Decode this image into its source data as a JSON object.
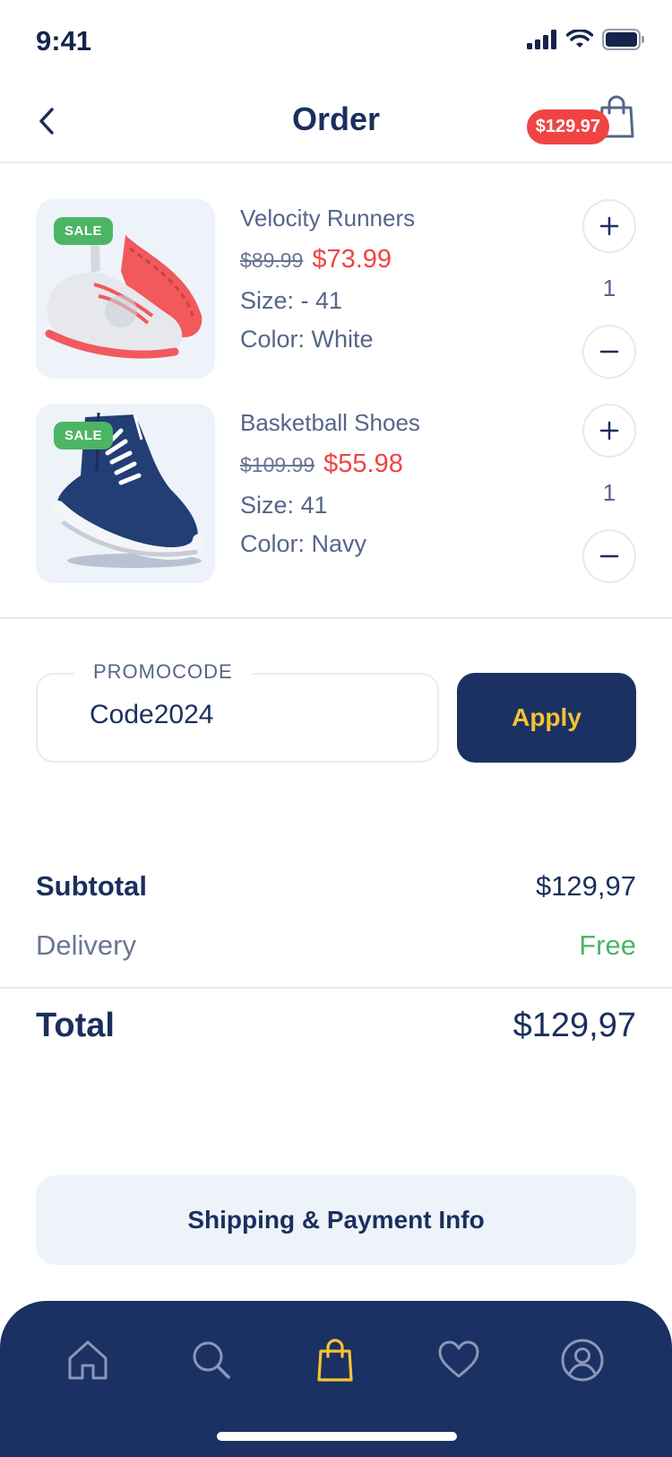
{
  "status_bar": {
    "time": "9:41"
  },
  "header": {
    "title": "Order",
    "cart_badge": "$129.97"
  },
  "items": [
    {
      "name": "Velocity Runners",
      "sale_label": "SALE",
      "old_price": "$89.99",
      "new_price": "$73.99",
      "size": "Size: - 41",
      "color": "Color: White",
      "quantity": "1"
    },
    {
      "name": "Basketball Shoes",
      "sale_label": "SALE",
      "old_price": "$109.99",
      "new_price": "$55.98",
      "size": "Size: 41",
      "color": "Color: Navy",
      "quantity": "1"
    }
  ],
  "promo": {
    "label": "PROMOCODE",
    "value": "Code2024",
    "apply_label": "Apply"
  },
  "summary": {
    "subtotal_label": "Subtotal",
    "subtotal_value": "$129,97",
    "delivery_label": "Delivery",
    "delivery_value": "Free",
    "total_label": "Total",
    "total_value": "$129,97"
  },
  "shipping_button_label": "Shipping & Payment Info",
  "tabs": [
    {
      "icon": "home-icon"
    },
    {
      "icon": "search-icon"
    },
    {
      "icon": "shopping-bag-icon",
      "active": true
    },
    {
      "icon": "heart-icon"
    },
    {
      "icon": "profile-icon"
    }
  ],
  "colors": {
    "navy": "#1b3163",
    "sale_green": "#4cb565",
    "price_red": "#f04443",
    "accent_yellow": "#f6c330",
    "muted_text": "#56658a"
  }
}
